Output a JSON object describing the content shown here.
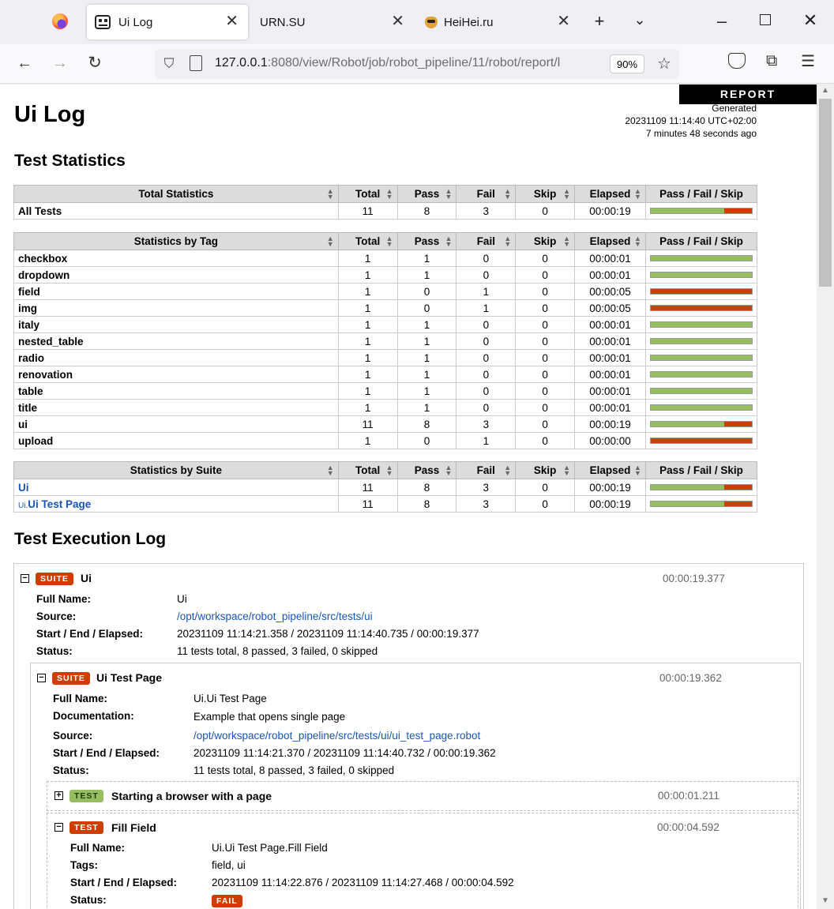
{
  "browser": {
    "tabs": [
      {
        "title": "Ui Log",
        "active": true
      },
      {
        "title": "URN.SU"
      },
      {
        "title": "HeiHei.ru"
      }
    ],
    "url_host": "127.0.0.1",
    "url_rest": ":8080/view/Robot/job/robot_pipeline/11/robot/report/l",
    "zoom": "90%"
  },
  "report_button": "REPORT",
  "title": "Ui Log",
  "generated": {
    "label": "Generated",
    "timestamp": "20231109 11:14:40 UTC+02:00",
    "ago": "7 minutes 48 seconds ago"
  },
  "headings": {
    "statistics": "Test Statistics",
    "log": "Test Execution Log"
  },
  "columns": [
    "Total",
    "Pass",
    "Fail",
    "Skip",
    "Elapsed",
    "Pass / Fail / Skip"
  ],
  "total_statistics": {
    "header": "Total Statistics",
    "rows": [
      {
        "name": "All Tests",
        "total": 11,
        "pass": 8,
        "fail": 3,
        "skip": 0,
        "elapsed": "00:00:19"
      }
    ]
  },
  "tag_statistics": {
    "header": "Statistics by Tag",
    "rows": [
      {
        "name": "checkbox",
        "total": 1,
        "pass": 1,
        "fail": 0,
        "skip": 0,
        "elapsed": "00:00:01"
      },
      {
        "name": "dropdown",
        "total": 1,
        "pass": 1,
        "fail": 0,
        "skip": 0,
        "elapsed": "00:00:01"
      },
      {
        "name": "field",
        "total": 1,
        "pass": 0,
        "fail": 1,
        "skip": 0,
        "elapsed": "00:00:05"
      },
      {
        "name": "img",
        "total": 1,
        "pass": 0,
        "fail": 1,
        "skip": 0,
        "elapsed": "00:00:05"
      },
      {
        "name": "italy",
        "total": 1,
        "pass": 1,
        "fail": 0,
        "skip": 0,
        "elapsed": "00:00:01"
      },
      {
        "name": "nested_table",
        "total": 1,
        "pass": 1,
        "fail": 0,
        "skip": 0,
        "elapsed": "00:00:01"
      },
      {
        "name": "radio",
        "total": 1,
        "pass": 1,
        "fail": 0,
        "skip": 0,
        "elapsed": "00:00:01"
      },
      {
        "name": "renovation",
        "total": 1,
        "pass": 1,
        "fail": 0,
        "skip": 0,
        "elapsed": "00:00:01"
      },
      {
        "name": "table",
        "total": 1,
        "pass": 1,
        "fail": 0,
        "skip": 0,
        "elapsed": "00:00:01"
      },
      {
        "name": "title",
        "total": 1,
        "pass": 1,
        "fail": 0,
        "skip": 0,
        "elapsed": "00:00:01"
      },
      {
        "name": "ui",
        "total": 11,
        "pass": 8,
        "fail": 3,
        "skip": 0,
        "elapsed": "00:00:19"
      },
      {
        "name": "upload",
        "total": 1,
        "pass": 0,
        "fail": 1,
        "skip": 0,
        "elapsed": "00:00:00"
      }
    ]
  },
  "suite_statistics": {
    "header": "Statistics by Suite",
    "rows": [
      {
        "name": "Ui",
        "prefix": "",
        "total": 11,
        "pass": 8,
        "fail": 3,
        "skip": 0,
        "elapsed": "00:00:19"
      },
      {
        "name": "Ui Test Page",
        "prefix": "Ui.",
        "total": 11,
        "pass": 8,
        "fail": 3,
        "skip": 0,
        "elapsed": "00:00:19"
      }
    ]
  },
  "log": {
    "suite_label": "SUITE",
    "test_label": "TEST",
    "fail_label": "FAIL",
    "suite1": {
      "name": "Ui",
      "elapsed": "00:00:19.377",
      "full_name_label": "Full Name:",
      "full_name": "Ui",
      "source_label": "Source:",
      "source": "/opt/workspace/robot_pipeline/src/tests/ui",
      "times_label": "Start / End / Elapsed:",
      "times": "20231109 11:14:21.358 / 20231109 11:14:40.735 / 00:00:19.377",
      "status_label": "Status:",
      "status": "11 tests total, 8 passed, 3 failed, 0 skipped"
    },
    "suite2": {
      "name": "Ui Test Page",
      "elapsed": "00:00:19.362",
      "full_name_label": "Full Name:",
      "full_name": "Ui.Ui Test Page",
      "doc_label": "Documentation:",
      "doc": "Example that opens single page",
      "source_label": "Source:",
      "source": "/opt/workspace/robot_pipeline/src/tests/ui/ui_test_page.robot",
      "times_label": "Start / End / Elapsed:",
      "times": "20231109 11:14:21.370 / 20231109 11:14:40.732 / 00:00:19.362",
      "status_label": "Status:",
      "status": "11 tests total, 8 passed, 3 failed, 0 skipped"
    },
    "test1": {
      "name": "Starting a browser with a page",
      "elapsed": "00:00:01.211"
    },
    "test2": {
      "name": "Fill Field",
      "elapsed": "00:00:04.592",
      "full_name_label": "Full Name:",
      "full_name": "Ui.Ui Test Page.Fill Field",
      "tags_label": "Tags:",
      "tags": "field, ui",
      "times_label": "Start / End / Elapsed:",
      "times": "20231109 11:14:22.876 / 20231109 11:14:27.468 / 00:00:04.592",
      "status_label": "Status:"
    }
  },
  "colors": {
    "pass": "#97bd61",
    "fail": "#ce3e01",
    "link": "#1a55b4"
  }
}
